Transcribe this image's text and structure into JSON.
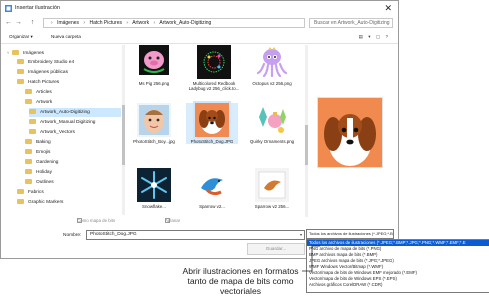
{
  "window": {
    "title": "Insertar ilustración",
    "close_glyph": "✕"
  },
  "nav": {
    "back_glyph": "←",
    "forward_glyph": "→",
    "up_glyph": "↑",
    "breadcrumb": [
      "Imágenes",
      "Hatch Pictures",
      "Artwork",
      "Artwork_Auto-Digitizing"
    ],
    "search_placeholder": "Buscar en Artwork_Auto-Digitizing"
  },
  "toolbar": {
    "organize_label": "Organizar ▾",
    "new_folder_label": "Nueva carpeta",
    "view_icons": "▤ ▾ ▢ ?"
  },
  "sidebar": {
    "items": [
      {
        "label": "Imágenes",
        "level": 0
      },
      {
        "label": "Embroidery Studio e4",
        "level": 1
      },
      {
        "label": "Imágenes públicas",
        "level": 1
      },
      {
        "label": "Hatch Pictures",
        "level": 1
      },
      {
        "label": "Articles",
        "level": 2
      },
      {
        "label": "Artwork",
        "level": 2
      },
      {
        "label": "Artwork_Auto-Digitizing",
        "level": 3,
        "selected": true
      },
      {
        "label": "Artwork_Manual Digitizing",
        "level": 3
      },
      {
        "label": "Artwork_Vectors",
        "level": 3
      },
      {
        "label": "Baking",
        "level": 2
      },
      {
        "label": "Emojis",
        "level": 2
      },
      {
        "label": "Gardening",
        "level": 2
      },
      {
        "label": "Holiday",
        "level": 2
      },
      {
        "label": "Outlines",
        "level": 2
      },
      {
        "label": "Fabrics",
        "level": 1
      },
      {
        "label": "Graphic Markers",
        "level": 1
      }
    ]
  },
  "files": [
    {
      "name": "Ms Pig 256.png",
      "icon": "pig-image"
    },
    {
      "name": "Multicolored Redbook Ladybug v2 256_click.to...",
      "icon": "ladybug-image"
    },
    {
      "name": "Octopus v2 256.png",
      "icon": "octopus-image"
    },
    {
      "name": "PhotoStitch_Boy...jpg",
      "icon": "baby-photo"
    },
    {
      "name": "PhotoStitch_Dog.JPG",
      "icon": "dog-photo",
      "selected": true
    },
    {
      "name": "Quirky Ornaments.png",
      "icon": "ornaments-image"
    },
    {
      "name": "Snowflake...",
      "icon": "snowflake-image"
    },
    {
      "name": "Sparrow v2...",
      "icon": "bird-image"
    },
    {
      "name": "Sparrow v2 256...",
      "icon": "bird-outline-image"
    }
  ],
  "options": {
    "bitmap_only_label": "Como mapa de bits",
    "flatten_label": "Aplanar"
  },
  "filename": {
    "label": "Nombre:",
    "value": "PhotoStitch_Dog.JPG"
  },
  "filter": {
    "selected": "Todos los archivos de ilustraciones (*.JPEG;*.BMP;*.JPG;*.PNG;*.WMF;*.EMF;*.E",
    "options": [
      "Todos los archivos de ilustraciones (*.JPEG;*.BMP;*.JPG;*.PNG;*.WMF;*.EMF;*.E",
      "PNG archivo de mapa de bits (*.PNG)",
      "BMP archivos mapa de bits (*.BMP)",
      "JPEG archivos mapa de bits (*.JPG;*.JPEG)",
      "WMF Windows Vector/Bitmap (*.WMF)",
      "Vector/mapa de bits de Windows EMF mejorado (*.EMF)",
      "Vector/mapa de bits de Windows EPS (*.EPS)",
      "Archivos gráficos CorelDRAW (*.CDR)"
    ]
  },
  "open_button_label": "Guardar...",
  "callout": {
    "text": "Abrir ilustraciones en formatos tanto de mapa de bits como vectoriales"
  }
}
